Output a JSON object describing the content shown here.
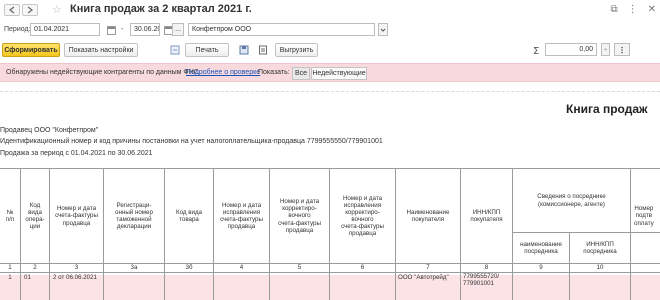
{
  "window": {
    "title": "Книга продаж за 2 квартал 2021 г."
  },
  "params": {
    "period_label": "Период:",
    "date_from": "01.04.2021",
    "date_separator": "-",
    "date_to": "30.06.2021",
    "more_label": "...",
    "organization": "Конфетпром ООО"
  },
  "toolbar": {
    "generate": "Сформировать",
    "show_settings": "Показать настройки",
    "print": "Печать",
    "export": "Выгрузить",
    "amount_value": "0,00"
  },
  "warning": {
    "text": "Обнаружены недействующие контрагенты по данным ФНС",
    "link": "Подробнее о проверке",
    "show_label": "Показать:",
    "filter_all": "Все",
    "filter_inactive": "Недействующие"
  },
  "document": {
    "heading": "Книга продаж",
    "seller": "Продавец  ООО \"Конфетпром\"",
    "inn_line": "Идентификационный номер и код причины постановки на учет налогоплательщика-продавца  7799555550/779901001",
    "period_line": "Продажа за период с 01.04.2021 по 30.06.2021"
  },
  "table": {
    "headers": {
      "num": "№\nп/п",
      "op_code": "Код\nвида\nопера-\nции",
      "invoice": "Номер и дата\nсчета-фактуры\nпродавца",
      "customs": "Регистраци-\nонный номер\nтаможенной\nдекларации",
      "goods_code": "Код вида\nтовара",
      "invoice_fix": "Номер и дата\nисправления\nсчета-фактуры\nпродавца",
      "corr_invoice": "Номер и дата\nкорректиро-\nвочного\nсчета-фактуры\nпродавца",
      "corr_fix": "Номер и дата\nисправления\nкорректиро-\nвочного\nсчета-фактуры\nпродавца",
      "buyer": "Наименование\nпокупателя",
      "buyer_inn": "ИНН/КПП\nпокупателя",
      "agent_group": "Сведения о посреднике\n(комиссионере, агенте)",
      "agent_name": "наименование\nпосредника",
      "agent_inn": "ИНН/КПП\nпосредника",
      "payment_doc": "Номер\nподтв\nоплату"
    },
    "numbering": [
      "1",
      "2",
      "3",
      "3а",
      "3б",
      "4",
      "5",
      "6",
      "7",
      "8",
      "9",
      "10"
    ],
    "row": {
      "num": "1",
      "op_code": "01",
      "invoice": "2 от 06.06.2021",
      "buyer": "ООО \"Автотрейд\"",
      "buyer_inn": "7799555720/\n779901001"
    }
  }
}
